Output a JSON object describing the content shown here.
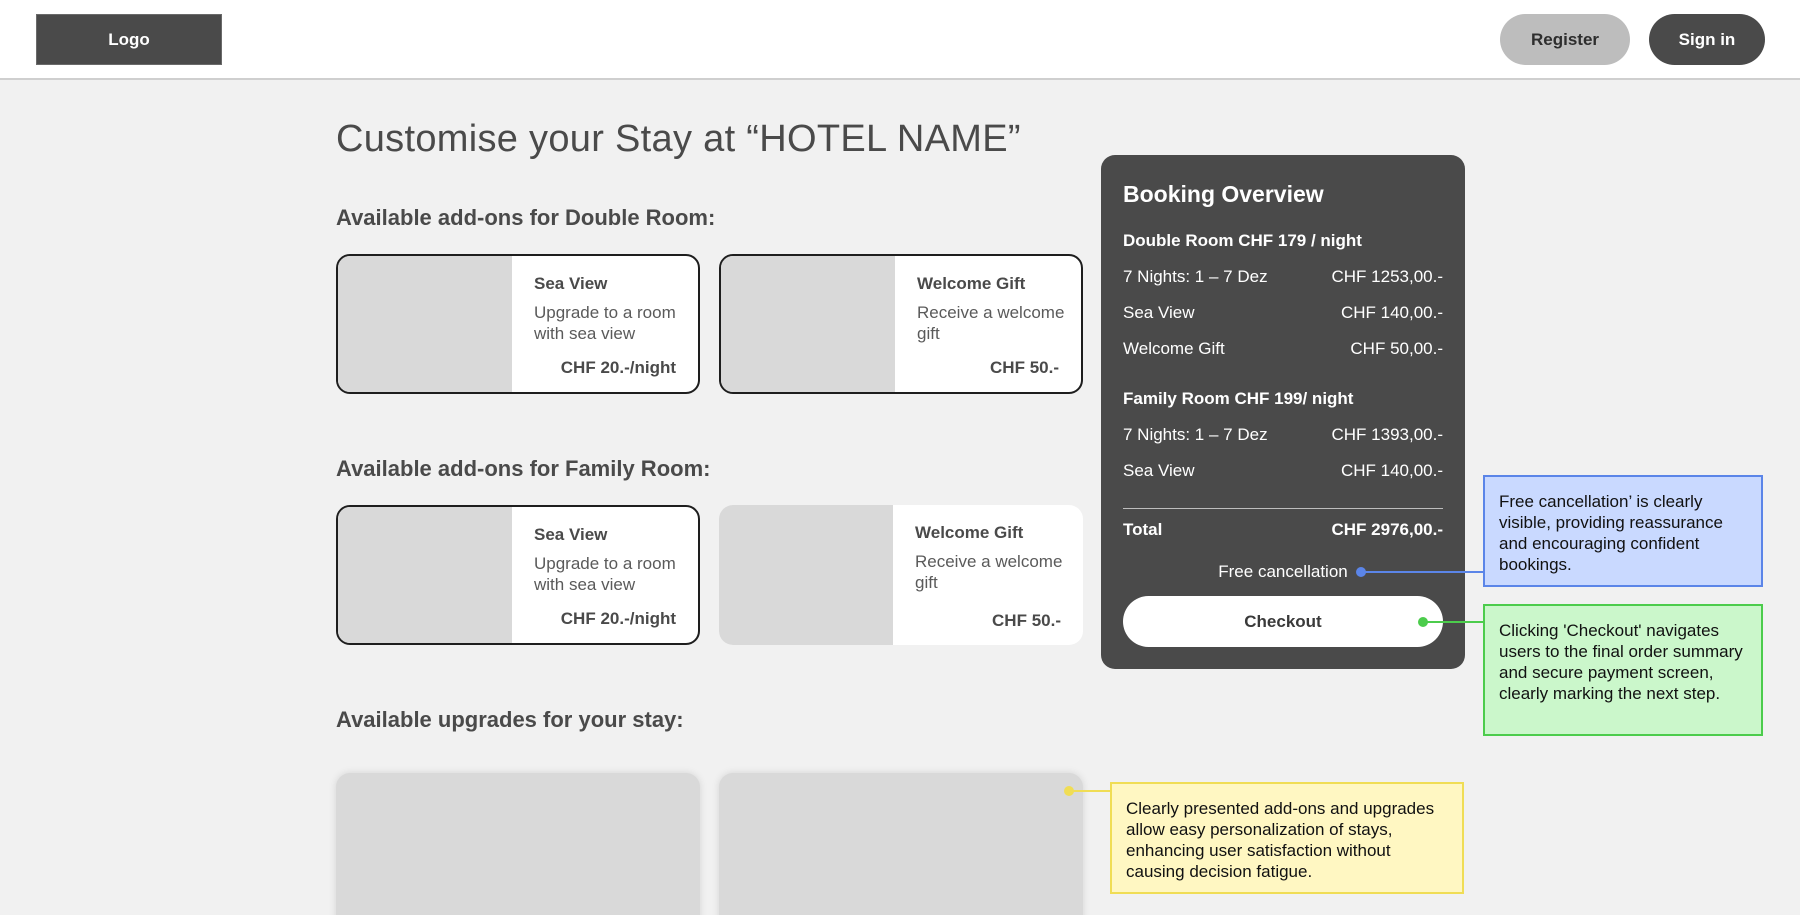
{
  "header": {
    "logo_label": "Logo",
    "register_label": "Register",
    "signin_label": "Sign in"
  },
  "main": {
    "page_title": "Customise your Stay at “HOTEL NAME”",
    "double_room_section": {
      "title": "Available add-ons for Double Room:",
      "addons": [
        {
          "title": "Sea View",
          "description": "Upgrade to a room with sea view",
          "price": "CHF 20.-/night",
          "selected": true
        },
        {
          "title": "Welcome Gift",
          "description": "Receive a welcome gift",
          "price": "CHF 50.-",
          "selected": true
        }
      ]
    },
    "family_room_section": {
      "title": "Available add-ons for Family Room:",
      "addons": [
        {
          "title": "Sea View",
          "description": "Upgrade to a room with sea view",
          "price": "CHF 20.-/night",
          "selected": true
        },
        {
          "title": "Welcome Gift",
          "description": "Receive a welcome gift",
          "price": "CHF 50.-",
          "selected": false
        }
      ]
    },
    "upgrades_section": {
      "title": "Available upgrades for your stay:"
    }
  },
  "overview": {
    "title": "Booking Overview",
    "double_room": {
      "heading": "Double Room CHF 179 / night",
      "rows": [
        {
          "label": "7 Nights: 1 – 7 Dez",
          "value": "CHF 1253,00.-"
        },
        {
          "label": "Sea View",
          "value": "CHF 140,00.-"
        },
        {
          "label": "Welcome Gift",
          "value": "CHF 50,00.-"
        }
      ]
    },
    "family_room": {
      "heading": "Family Room CHF 199/ night",
      "rows": [
        {
          "label": "7 Nights: 1 – 7 Dez",
          "value": "CHF 1393,00.-"
        },
        {
          "label": "Sea View",
          "value": "CHF 140,00.-"
        }
      ]
    },
    "total_label": "Total",
    "total_value": "CHF 2976,00.-",
    "free_cancellation": "Free cancellation",
    "checkout_label": "Checkout"
  },
  "annotations": {
    "cancellation_note": "Free cancellation’ is clearly visible, providing reassurance and encouraging confident bookings.",
    "checkout_note": "Clicking 'Checkout' navigates users to the final order summary and secure payment screen, clearly marking the next step.",
    "addons_note": "Clearly presented add-ons and upgrades allow easy personalization of stays, enhancing user satisfaction without causing decision fatigue."
  },
  "colors": {
    "overview_bg": "#4a4a4a",
    "note_blue": "#c9d9ff",
    "note_green": "#cbf7cb",
    "note_yellow": "#fff7c2"
  }
}
